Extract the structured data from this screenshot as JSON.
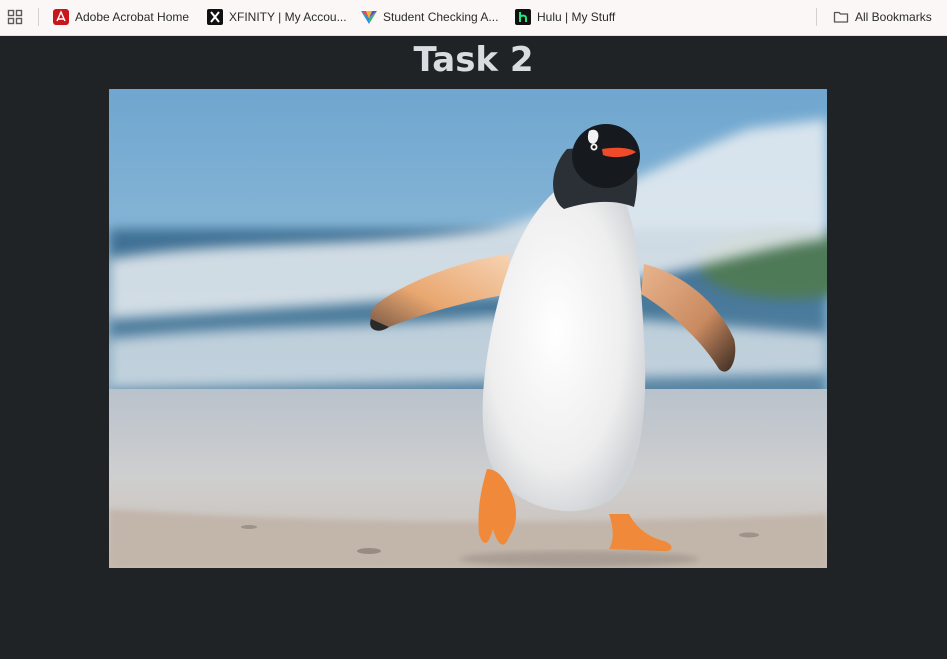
{
  "bookmarks_bar": {
    "items": [
      {
        "label": "Adobe Acrobat Home",
        "icon": "adobe-acrobat-icon"
      },
      {
        "label": "XFINITY | My Accou...",
        "icon": "x-logo-icon"
      },
      {
        "label": "Student Checking A...",
        "icon": "colorful-v-icon"
      },
      {
        "label": "Hulu | My Stuff",
        "icon": "hulu-icon"
      }
    ],
    "all_bookmarks_label": "All Bookmarks"
  },
  "page": {
    "title": "Task 2",
    "image_alt": "Gentoo penguin walking on a beach"
  },
  "colors": {
    "page_background": "#202326",
    "bookmarks_background": "#fbf7f7",
    "title_text": "#d7dde1"
  }
}
